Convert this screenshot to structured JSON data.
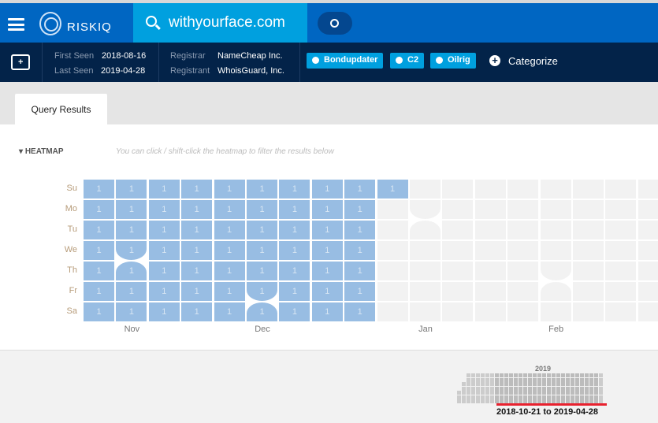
{
  "header": {
    "brand": "RISKIQ",
    "query": "withyourface.com"
  },
  "info": {
    "first_seen_label": "First Seen",
    "first_seen": "2018-08-16",
    "last_seen_label": "Last Seen",
    "last_seen": "2019-04-28",
    "registrar_label": "Registrar",
    "registrar": "NameCheap Inc.",
    "registrant_label": "Registrant",
    "registrant": "WhoisGuard, Inc.",
    "tags": [
      "Bondupdater",
      "C2",
      "Oilrig"
    ],
    "categorize": "Categorize"
  },
  "tabs": {
    "active": "Query Results"
  },
  "heatmap": {
    "title": "HEATMAP",
    "hint": "You can click / shift-click the heatmap to filter the results below",
    "days": [
      "Su",
      "Mo",
      "Tu",
      "We",
      "Th",
      "Fr",
      "Sa"
    ],
    "months": [
      {
        "label": "Nov",
        "week": 1
      },
      {
        "label": "Dec",
        "week": 5
      },
      {
        "label": "Jan",
        "week": 10
      },
      {
        "label": "Feb",
        "week": 14
      }
    ],
    "weeks": [
      [
        1,
        1,
        1,
        1,
        1,
        1,
        1
      ],
      [
        1,
        1,
        1,
        1,
        1,
        1,
        1
      ],
      [
        1,
        1,
        1,
        1,
        1,
        1,
        1
      ],
      [
        1,
        1,
        1,
        1,
        1,
        1,
        1
      ],
      [
        1,
        1,
        1,
        1,
        1,
        1,
        1
      ],
      [
        1,
        1,
        1,
        1,
        1,
        1,
        1
      ],
      [
        1,
        1,
        1,
        1,
        1,
        1,
        1
      ],
      [
        1,
        1,
        1,
        1,
        1,
        1,
        1
      ],
      [
        1,
        1,
        1,
        1,
        1,
        1,
        1
      ],
      [
        1,
        null,
        null,
        null,
        null,
        null,
        null
      ],
      [
        null,
        null,
        null,
        null,
        null,
        null,
        null
      ],
      [
        null,
        null,
        null,
        null,
        null,
        null,
        null
      ],
      [
        null,
        null,
        null,
        null,
        null,
        null,
        null
      ],
      [
        null,
        null,
        null,
        null,
        null,
        null,
        null
      ],
      [
        null,
        null,
        null,
        null,
        null,
        null,
        null
      ],
      [
        null,
        null,
        null,
        null,
        null,
        null,
        null
      ],
      [
        null,
        null,
        null,
        null,
        null,
        null,
        null
      ],
      [
        null,
        null,
        null,
        null,
        null,
        null,
        null
      ]
    ],
    "colors": {
      "active": "#98bde3",
      "empty": "#f2f2f2"
    }
  },
  "overview": {
    "year": "2019",
    "range": "2018-10-21 to 2019-04-28"
  }
}
